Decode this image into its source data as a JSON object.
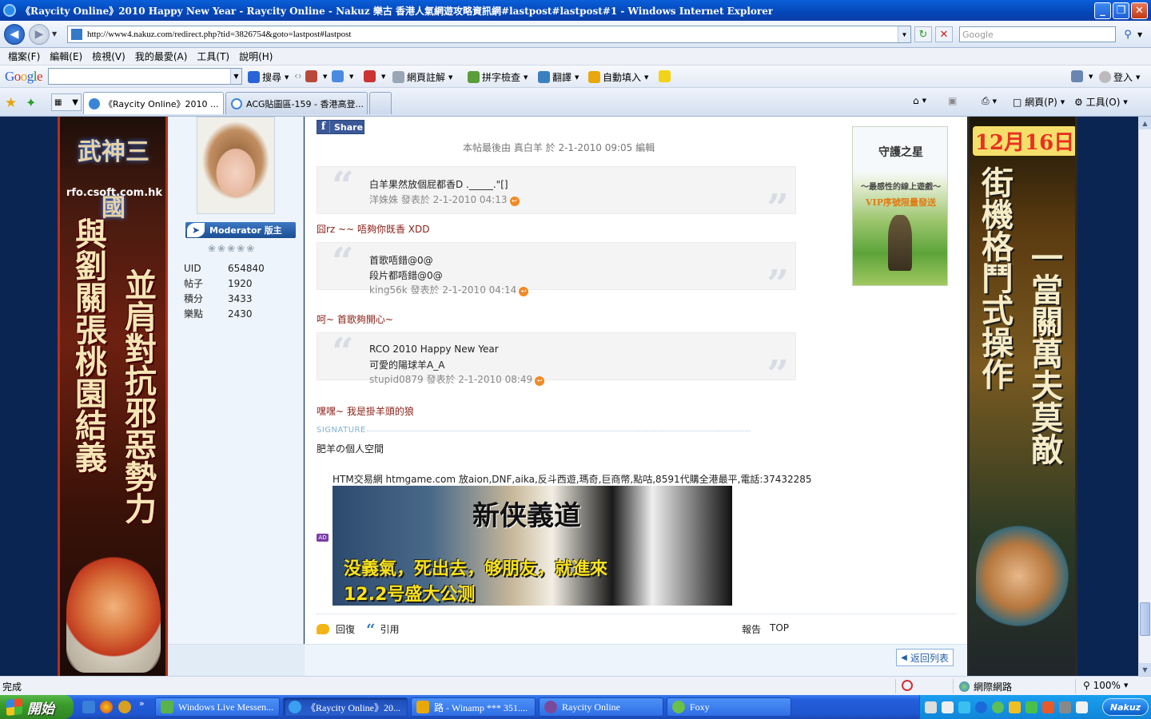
{
  "window": {
    "title": "《Raycity Online》2010 Happy New Year - Raycity Online - Nakuz 樂古 香港人氣網遊攻略資訊網#lastpost#lastpost#1 - Windows Internet Explorer",
    "minimize": "_",
    "maximize": "❐",
    "close": "✕"
  },
  "address": {
    "url": "http://www4.nakuz.com/redirect.php?tid=3826754&goto=lastpost#lastpost",
    "search_placeholder": "Google"
  },
  "menu": [
    "檔案(F)",
    "編輯(E)",
    "檢視(V)",
    "我的最愛(A)",
    "工具(T)",
    "說明(H)"
  ],
  "google_toolbar": {
    "search": "搜尋",
    "page_annotate": "網頁註解",
    "spellcheck": "拼字檢查",
    "translate": "翻譯",
    "autofill": "自動填入",
    "login": "登入"
  },
  "tabs": [
    {
      "label": "《Raycity Online》2010 ...",
      "active": true
    },
    {
      "label": "ACG貼圖區-159 - 香港高登...",
      "active": false
    }
  ],
  "command_bar": {
    "page": "網頁(P)",
    "tools": "工具(O)"
  },
  "user": {
    "badge": "Moderator 版主",
    "stats": [
      {
        "label": "UID",
        "value": "654840"
      },
      {
        "label": "帖子",
        "value": "1920"
      },
      {
        "label": "積分",
        "value": "3433"
      },
      {
        "label": "樂點",
        "value": "2430"
      }
    ]
  },
  "post": {
    "share": "Share",
    "edit_note": "本帖最後由 真白羊 於 2-1-2010 09:05 編輯",
    "quote1": {
      "lines": [
        "白羊果然放個屁都香D ._____.\"[]"
      ],
      "meta": "洋姝姝 發表於 2-1-2010 04:13"
    },
    "reply1": "囧rz ~~ 唔夠你既香 XDD",
    "quote2": {
      "lines": [
        "首歌唔錯@0@",
        "段片都唔錯@0@"
      ],
      "meta": "king56k 發表於 2-1-2010 04:14"
    },
    "reply2": "呵~ 首歌夠開心~",
    "quote3": {
      "lines": [
        "RCO 2010 Happy New Year",
        "可愛的陽球羊A_A"
      ],
      "meta": "stupid0879 發表於 2-1-2010 08:49"
    },
    "reply3": "嘿嘿~ 我是掛羊頭的狼",
    "signature_label": "SIGNATURE",
    "signature_name": "肥羊の個人空間",
    "ad_text": "HTM交易網 htmgame.com 放aion,DNF,aika,反斗西遊,瑪奇,巨商幣,點咕,8591代購全港最平,電話:37432285",
    "ad_badge": "AD",
    "ad_image": {
      "title": "新侠義道",
      "slogan": "没義氣，死出去，够朋友，就進來",
      "date": "12.2号盛大公测"
    },
    "actions": {
      "reply": "回復",
      "quote": "引用",
      "report": "報告",
      "top": "TOP"
    },
    "back_list": "返回列表"
  },
  "banners": {
    "left": {
      "logo": "武神三國",
      "site": "rfo.csoft.com.hk",
      "col1": "與劉關張桃園結義",
      "col2": "並肩對抗邪惡勢力"
    },
    "right": {
      "date": "12月16日",
      "col1": "街機格鬥式操作",
      "col2": "一當關萬夫莫敵"
    },
    "side_ad": {
      "logo": "守護之星",
      "tag1": "～最感性的線上遊戲～",
      "tag2": "VIP序號限量發送"
    }
  },
  "status": {
    "text": "完成",
    "zone": "網際網路",
    "zoom": "100%"
  },
  "taskbar": {
    "start": "開始",
    "tasks": [
      {
        "label": "Windows Live Messen..."
      },
      {
        "label": "《Raycity Online》20..."
      },
      {
        "label": "路 - Winamp *** 351...."
      },
      {
        "label": "Raycity Online"
      },
      {
        "label": "Foxy"
      }
    ],
    "tray_logo": "Nakuz"
  }
}
